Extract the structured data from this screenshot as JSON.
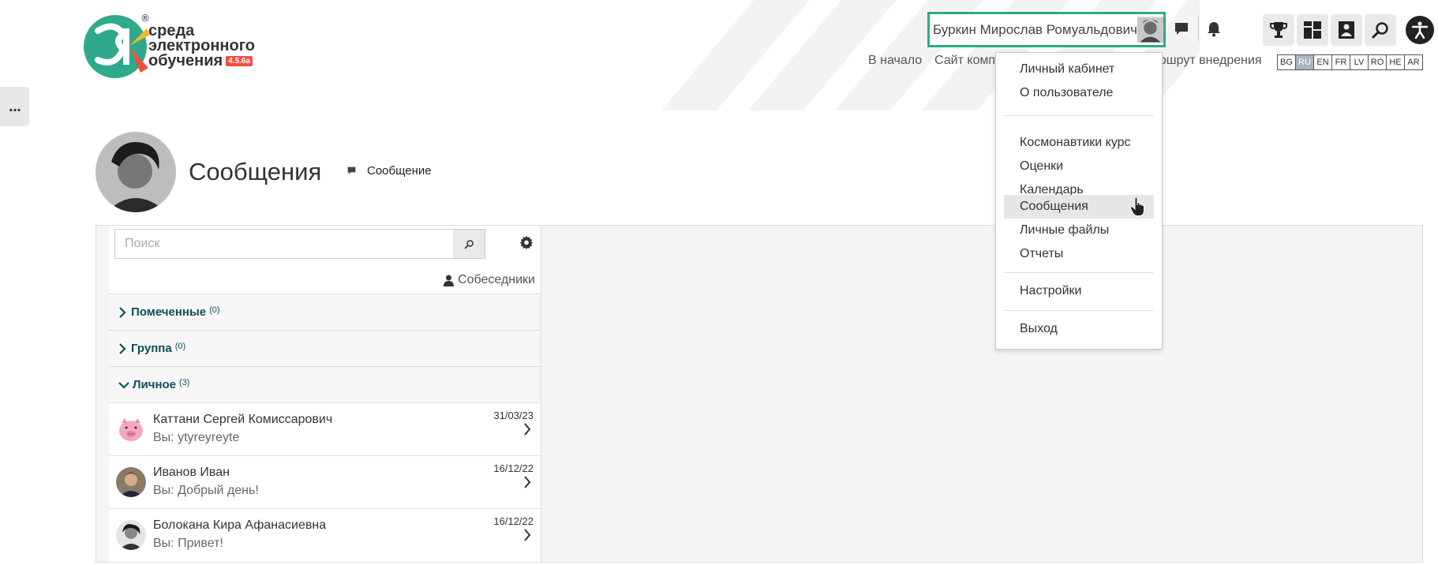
{
  "logo": {
    "line1": "среда",
    "line2": "электронного",
    "line3": "обучения",
    "version": "4.5.6a",
    "registered": "®",
    "colors": {
      "green": "#2fa98b",
      "red": "#f0503c",
      "yellow": "#f6b52a"
    }
  },
  "side_toggle": {
    "label": "..."
  },
  "user": {
    "name": "Буркин Мирослав Ромуальдович",
    "border_color": "#2fa98b"
  },
  "header_icons": {
    "messages": "chat-bubble-icon",
    "notifications": "bell-icon",
    "tools": [
      "trophy-icon",
      "dashboard-grid-icon",
      "user-card-icon",
      "search-icon"
    ],
    "accessibility": "accessibility-icon"
  },
  "topnav": {
    "home": "В начало",
    "site": "Сайт компа",
    "route": "аршрут внедрения"
  },
  "languages": [
    {
      "code": "BG",
      "active": false
    },
    {
      "code": "RU",
      "active": true
    },
    {
      "code": "EN",
      "active": false
    },
    {
      "code": "FR",
      "active": false
    },
    {
      "code": "LV",
      "active": false
    },
    {
      "code": "RO",
      "active": false
    },
    {
      "code": "HE",
      "active": false
    },
    {
      "code": "AR",
      "active": false
    }
  ],
  "page": {
    "title": "Сообщения",
    "action_label": "Сообщение"
  },
  "messaging": {
    "search_placeholder": "Поиск",
    "contacts_label": "Собеседники",
    "sections": [
      {
        "name": "Помеченные",
        "count": "(0)",
        "expanded": false
      },
      {
        "name": "Группа",
        "count": "(0)",
        "expanded": false
      },
      {
        "name": "Личное",
        "count": "(3)",
        "expanded": true
      }
    ],
    "conversations": [
      {
        "name": "Каттани Сергей Комиссарович",
        "last": "Вы: ytyreyreyte",
        "date": "31/03/23",
        "avatar": "pig-avatar-icon"
      },
      {
        "name": "Иванов Иван",
        "last": "Вы: Добрый день!",
        "date": "16/12/22",
        "avatar": "user-photo"
      },
      {
        "name": "Болокана Кира Афанасиевна",
        "last": "Вы: Привет!",
        "date": "16/12/22",
        "avatar": "user-photo"
      }
    ]
  },
  "user_menu": {
    "items": [
      {
        "label": "Личный кабинет",
        "group": 1
      },
      {
        "label": "О пользователе",
        "group": 1
      },
      {
        "label": "Космонавтики курс",
        "group": 2
      },
      {
        "label": "Оценки",
        "group": 2
      },
      {
        "label": "Календарь",
        "group": 2
      },
      {
        "label": "Сообщения",
        "group": 2,
        "hover": true
      },
      {
        "label": "Личные файлы",
        "group": 2
      },
      {
        "label": "Отчеты",
        "group": 2
      },
      {
        "label": "Настройки",
        "group": 3
      },
      {
        "label": "Выход",
        "group": 4
      }
    ]
  }
}
